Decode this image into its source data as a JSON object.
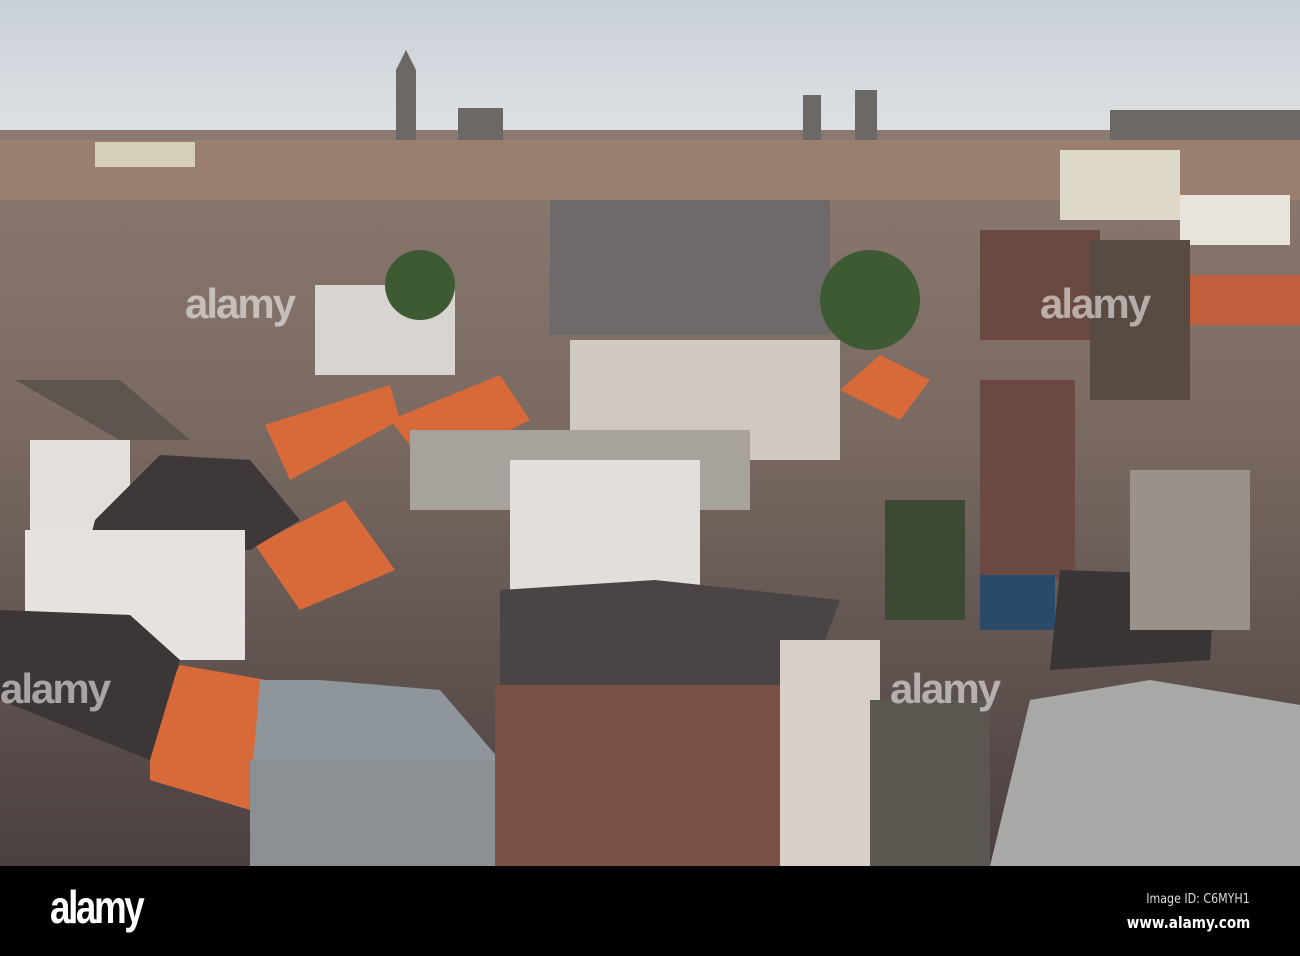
{
  "watermark": {
    "text": "alamy"
  },
  "footer": {
    "logo": "alamy",
    "image_id": "Image ID: C6MYH1",
    "website": "www.alamy.com"
  }
}
